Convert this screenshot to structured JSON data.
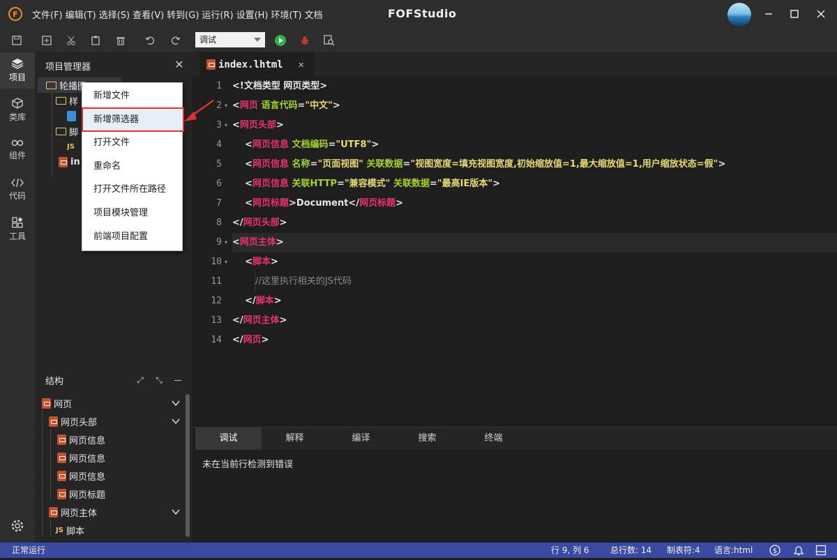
{
  "window": {
    "app_title": "FOFStudio",
    "logo_letter": "F"
  },
  "menu": [
    "文件(F)",
    "编辑(T)",
    "选择(S)",
    "查看(V)",
    "转到(G)",
    "运行(R)",
    "设置(H)",
    "环境(T)",
    "文档"
  ],
  "toolbar": {
    "mode_value": "调试"
  },
  "activity": [
    {
      "label": "项目",
      "icon": "layers-icon"
    },
    {
      "label": "类库",
      "icon": "cube-icon"
    },
    {
      "label": "组件",
      "icon": "link-icon"
    },
    {
      "label": "代码",
      "icon": "code-icon"
    },
    {
      "label": "工具",
      "icon": "tools-icon"
    }
  ],
  "project": {
    "title": "项目管理器",
    "tree": [
      "轮播图",
      "样",
      "脚",
      "JS",
      "in"
    ]
  },
  "context_menu": {
    "items": [
      "新增文件",
      "新增筛选器",
      "打开文件",
      "重命名",
      "打开文件所在路径",
      "项目模块管理",
      "前端项目配置"
    ],
    "highlighted_index": 1
  },
  "structure": {
    "title": "结构",
    "items": [
      "网页",
      "网页头部",
      "网页信息",
      "网页信息",
      "网页信息",
      "网页标题",
      "网页主体",
      "JS",
      "脚本"
    ]
  },
  "tab": {
    "filename": "index.lhtml"
  },
  "editor": {
    "line_numbers": [
      "1",
      "2",
      "3",
      "4",
      "5",
      "6",
      "7",
      "8",
      "9",
      "10",
      "11",
      "12",
      "13",
      "14"
    ],
    "lines": [
      [
        {
          "c": "p",
          "t": "<!文档类型 网页类型>"
        }
      ],
      [
        {
          "c": "p",
          "t": "<"
        },
        {
          "c": "t",
          "t": "网页"
        },
        {
          "c": "a",
          "t": " 语言代码"
        },
        {
          "c": "p",
          "t": "="
        },
        {
          "c": "s",
          "t": "\"中文\""
        },
        {
          "c": "p",
          "t": ">"
        }
      ],
      [
        {
          "c": "p",
          "t": "<"
        },
        {
          "c": "t",
          "t": "网页头部"
        },
        {
          "c": "p",
          "t": ">"
        }
      ],
      [
        {
          "c": "p",
          "t": "    <"
        },
        {
          "c": "t",
          "t": "网页信息"
        },
        {
          "c": "a",
          "t": " 文档编码"
        },
        {
          "c": "p",
          "t": "="
        },
        {
          "c": "s",
          "t": "\"UTF8\""
        },
        {
          "c": "p",
          "t": ">"
        }
      ],
      [
        {
          "c": "p",
          "t": "    <"
        },
        {
          "c": "t",
          "t": "网页信息"
        },
        {
          "c": "a",
          "t": " 名称"
        },
        {
          "c": "p",
          "t": "="
        },
        {
          "c": "s",
          "t": "\"页面视图\""
        },
        {
          "c": "a",
          "t": " 关联数据"
        },
        {
          "c": "p",
          "t": "="
        },
        {
          "c": "s",
          "t": "\"视图宽度=填充视图宽度,初始缩放值=1,最大缩放值=1,用户缩放状态=假\""
        },
        {
          "c": "p",
          "t": ">"
        }
      ],
      [
        {
          "c": "p",
          "t": "    <"
        },
        {
          "c": "t",
          "t": "网页信息"
        },
        {
          "c": "a",
          "t": " 关联HTTP"
        },
        {
          "c": "p",
          "t": "="
        },
        {
          "c": "s",
          "t": "\"兼容模式\""
        },
        {
          "c": "a",
          "t": " 关联数据"
        },
        {
          "c": "p",
          "t": "="
        },
        {
          "c": "s",
          "t": "\"最高IE版本\""
        },
        {
          "c": "p",
          "t": ">"
        }
      ],
      [
        {
          "c": "p",
          "t": "    <"
        },
        {
          "c": "t",
          "t": "网页标题"
        },
        {
          "c": "p",
          "t": ">Document</"
        },
        {
          "c": "t",
          "t": "网页标题"
        },
        {
          "c": "p",
          "t": ">"
        }
      ],
      [
        {
          "c": "p",
          "t": "</"
        },
        {
          "c": "t",
          "t": "网页头部"
        },
        {
          "c": "p",
          "t": ">"
        }
      ],
      [
        {
          "c": "p",
          "t": "<"
        },
        {
          "c": "t",
          "t": "网页主体"
        },
        {
          "c": "p",
          "t": ">"
        }
      ],
      [
        {
          "c": "p",
          "t": "    <"
        },
        {
          "c": "t",
          "t": "脚本"
        },
        {
          "c": "p",
          "t": ">"
        }
      ],
      [
        {
          "c": "c",
          "t": "        //这里执行相关的JS代码"
        }
      ],
      [
        {
          "c": "p",
          "t": "    </"
        },
        {
          "c": "t",
          "t": "脚本"
        },
        {
          "c": "p",
          "t": ">"
        }
      ],
      [
        {
          "c": "p",
          "t": "</"
        },
        {
          "c": "t",
          "t": "网页主体"
        },
        {
          "c": "p",
          "t": ">"
        }
      ],
      [
        {
          "c": "p",
          "t": "</"
        },
        {
          "c": "t",
          "t": "网页"
        },
        {
          "c": "p",
          "t": ">"
        }
      ]
    ]
  },
  "bottom": {
    "tabs": [
      "调试",
      "解释",
      "编译",
      "搜索",
      "终端"
    ],
    "message": "未在当前行检测到错误"
  },
  "status": {
    "left": "正常运行",
    "position": "行 9, 列 6",
    "total_lines": "总行数: 14",
    "tab_size": "制表符:4",
    "language": "语言:html"
  },
  "colors": {
    "accent": "#3a4aa3",
    "tag": "#e8336b",
    "attr": "#a6d22e",
    "string": "#e6db74",
    "highlight_box": "#e03030"
  }
}
